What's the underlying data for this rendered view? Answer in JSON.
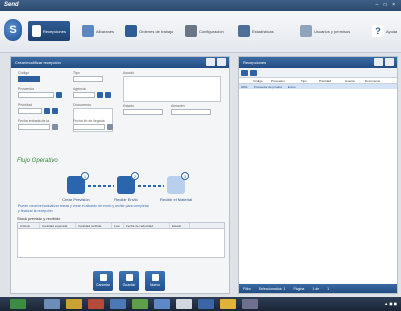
{
  "app": {
    "title": "Send",
    "window_controls": "– □ ×"
  },
  "toolbar": {
    "items": [
      {
        "label": "Recepciones",
        "active": true
      },
      {
        "label": "Albaranes",
        "active": false
      },
      {
        "label": "Ordenes de trabajo",
        "active": false
      },
      {
        "label": "Configuración",
        "active": false
      },
      {
        "label": "Estadísticas",
        "active": false
      },
      {
        "label": "Usuarios y permisos",
        "active": false
      },
      {
        "label": "Ayuda",
        "active": false
      }
    ]
  },
  "left": {
    "title": "Crear/modificar recepción",
    "fields": {
      "codigo": {
        "label": "Código",
        "value": "0001"
      },
      "tipo": {
        "label": "Tipo",
        "value": "Estándar"
      },
      "asunto": {
        "label": "Asunto"
      },
      "proveedor": {
        "label": "Proveedor",
        "value": "Proveedor"
      },
      "agencia": {
        "label": "Agencia",
        "value": "Envío"
      },
      "prioridad": {
        "label": "Prioridad",
        "value": "Baja"
      },
      "documento": {
        "label": "Documento"
      },
      "estado": {
        "label": "Estado",
        "value": "Pendiente"
      },
      "almacen": {
        "label": "Almacén",
        "value": "Alm. gral."
      },
      "fecha_entrada": {
        "label": "Fecha entrada de la",
        "value": ""
      },
      "fecha_llegada": {
        "label": "Fecha fin de llegada",
        "value": "dd/mm/aaaa"
      }
    },
    "flow": {
      "label": "Flujo Operativo",
      "steps": [
        {
          "num": "1",
          "label": "Crear Previsión",
          "state": "done"
        },
        {
          "num": "2",
          "label": "Recibir Envió",
          "state": "done"
        },
        {
          "num": "3",
          "label": "Recibir el Material",
          "state": "todo"
        }
      ],
      "info_1": "Puede crear/ver/actualizar líneas y crear el albarán de envió y recibir para completar",
      "info_2": "y finalizar la recepción"
    },
    "grid": {
      "title": "Stock previsto y recibido",
      "columns": [
        "Artículo",
        "Cantidad esperada",
        "Cantidad recibida",
        "Lote",
        "Fecha de caducidad",
        "Estado"
      ]
    },
    "actions": [
      {
        "label": "Cancelar"
      },
      {
        "label": "Guardar"
      },
      {
        "label": "Nuevo"
      }
    ]
  },
  "right": {
    "title": "Recepciones",
    "columns": [
      "Código",
      "Proveedor",
      "Tipo",
      "Prioridad",
      "Cuenta",
      "Documento"
    ],
    "rows": [
      {
        "codigo": "0001",
        "proveedor": "Proveedor de prueba",
        "tipo": "Envío"
      }
    ],
    "footer": [
      "Filtro",
      "Seleccionados: 1",
      "Página",
      "1 de",
      "1"
    ]
  },
  "colors": {
    "accent": "#2b65ad",
    "header": "#224d82",
    "flow": "#2e8a3a"
  }
}
